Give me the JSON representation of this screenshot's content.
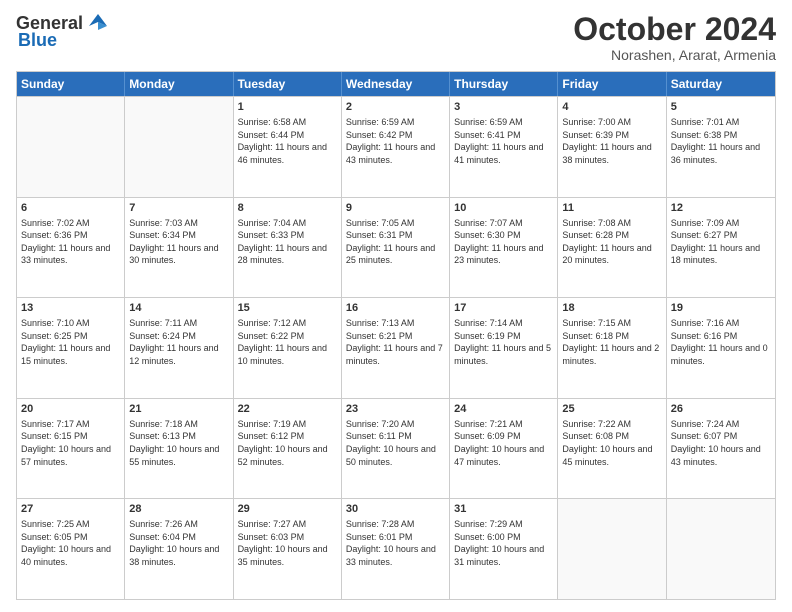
{
  "header": {
    "logo_general": "General",
    "logo_blue": "Blue",
    "month_title": "October 2024",
    "location": "Norashen, Ararat, Armenia"
  },
  "days_of_week": [
    "Sunday",
    "Monday",
    "Tuesday",
    "Wednesday",
    "Thursday",
    "Friday",
    "Saturday"
  ],
  "weeks": [
    [
      {
        "day": "",
        "text": ""
      },
      {
        "day": "",
        "text": ""
      },
      {
        "day": "1",
        "text": "Sunrise: 6:58 AM\nSunset: 6:44 PM\nDaylight: 11 hours and 46 minutes."
      },
      {
        "day": "2",
        "text": "Sunrise: 6:59 AM\nSunset: 6:42 PM\nDaylight: 11 hours and 43 minutes."
      },
      {
        "day": "3",
        "text": "Sunrise: 6:59 AM\nSunset: 6:41 PM\nDaylight: 11 hours and 41 minutes."
      },
      {
        "day": "4",
        "text": "Sunrise: 7:00 AM\nSunset: 6:39 PM\nDaylight: 11 hours and 38 minutes."
      },
      {
        "day": "5",
        "text": "Sunrise: 7:01 AM\nSunset: 6:38 PM\nDaylight: 11 hours and 36 minutes."
      }
    ],
    [
      {
        "day": "6",
        "text": "Sunrise: 7:02 AM\nSunset: 6:36 PM\nDaylight: 11 hours and 33 minutes."
      },
      {
        "day": "7",
        "text": "Sunrise: 7:03 AM\nSunset: 6:34 PM\nDaylight: 11 hours and 30 minutes."
      },
      {
        "day": "8",
        "text": "Sunrise: 7:04 AM\nSunset: 6:33 PM\nDaylight: 11 hours and 28 minutes."
      },
      {
        "day": "9",
        "text": "Sunrise: 7:05 AM\nSunset: 6:31 PM\nDaylight: 11 hours and 25 minutes."
      },
      {
        "day": "10",
        "text": "Sunrise: 7:07 AM\nSunset: 6:30 PM\nDaylight: 11 hours and 23 minutes."
      },
      {
        "day": "11",
        "text": "Sunrise: 7:08 AM\nSunset: 6:28 PM\nDaylight: 11 hours and 20 minutes."
      },
      {
        "day": "12",
        "text": "Sunrise: 7:09 AM\nSunset: 6:27 PM\nDaylight: 11 hours and 18 minutes."
      }
    ],
    [
      {
        "day": "13",
        "text": "Sunrise: 7:10 AM\nSunset: 6:25 PM\nDaylight: 11 hours and 15 minutes."
      },
      {
        "day": "14",
        "text": "Sunrise: 7:11 AM\nSunset: 6:24 PM\nDaylight: 11 hours and 12 minutes."
      },
      {
        "day": "15",
        "text": "Sunrise: 7:12 AM\nSunset: 6:22 PM\nDaylight: 11 hours and 10 minutes."
      },
      {
        "day": "16",
        "text": "Sunrise: 7:13 AM\nSunset: 6:21 PM\nDaylight: 11 hours and 7 minutes."
      },
      {
        "day": "17",
        "text": "Sunrise: 7:14 AM\nSunset: 6:19 PM\nDaylight: 11 hours and 5 minutes."
      },
      {
        "day": "18",
        "text": "Sunrise: 7:15 AM\nSunset: 6:18 PM\nDaylight: 11 hours and 2 minutes."
      },
      {
        "day": "19",
        "text": "Sunrise: 7:16 AM\nSunset: 6:16 PM\nDaylight: 11 hours and 0 minutes."
      }
    ],
    [
      {
        "day": "20",
        "text": "Sunrise: 7:17 AM\nSunset: 6:15 PM\nDaylight: 10 hours and 57 minutes."
      },
      {
        "day": "21",
        "text": "Sunrise: 7:18 AM\nSunset: 6:13 PM\nDaylight: 10 hours and 55 minutes."
      },
      {
        "day": "22",
        "text": "Sunrise: 7:19 AM\nSunset: 6:12 PM\nDaylight: 10 hours and 52 minutes."
      },
      {
        "day": "23",
        "text": "Sunrise: 7:20 AM\nSunset: 6:11 PM\nDaylight: 10 hours and 50 minutes."
      },
      {
        "day": "24",
        "text": "Sunrise: 7:21 AM\nSunset: 6:09 PM\nDaylight: 10 hours and 47 minutes."
      },
      {
        "day": "25",
        "text": "Sunrise: 7:22 AM\nSunset: 6:08 PM\nDaylight: 10 hours and 45 minutes."
      },
      {
        "day": "26",
        "text": "Sunrise: 7:24 AM\nSunset: 6:07 PM\nDaylight: 10 hours and 43 minutes."
      }
    ],
    [
      {
        "day": "27",
        "text": "Sunrise: 7:25 AM\nSunset: 6:05 PM\nDaylight: 10 hours and 40 minutes."
      },
      {
        "day": "28",
        "text": "Sunrise: 7:26 AM\nSunset: 6:04 PM\nDaylight: 10 hours and 38 minutes."
      },
      {
        "day": "29",
        "text": "Sunrise: 7:27 AM\nSunset: 6:03 PM\nDaylight: 10 hours and 35 minutes."
      },
      {
        "day": "30",
        "text": "Sunrise: 7:28 AM\nSunset: 6:01 PM\nDaylight: 10 hours and 33 minutes."
      },
      {
        "day": "31",
        "text": "Sunrise: 7:29 AM\nSunset: 6:00 PM\nDaylight: 10 hours and 31 minutes."
      },
      {
        "day": "",
        "text": ""
      },
      {
        "day": "",
        "text": ""
      }
    ]
  ]
}
